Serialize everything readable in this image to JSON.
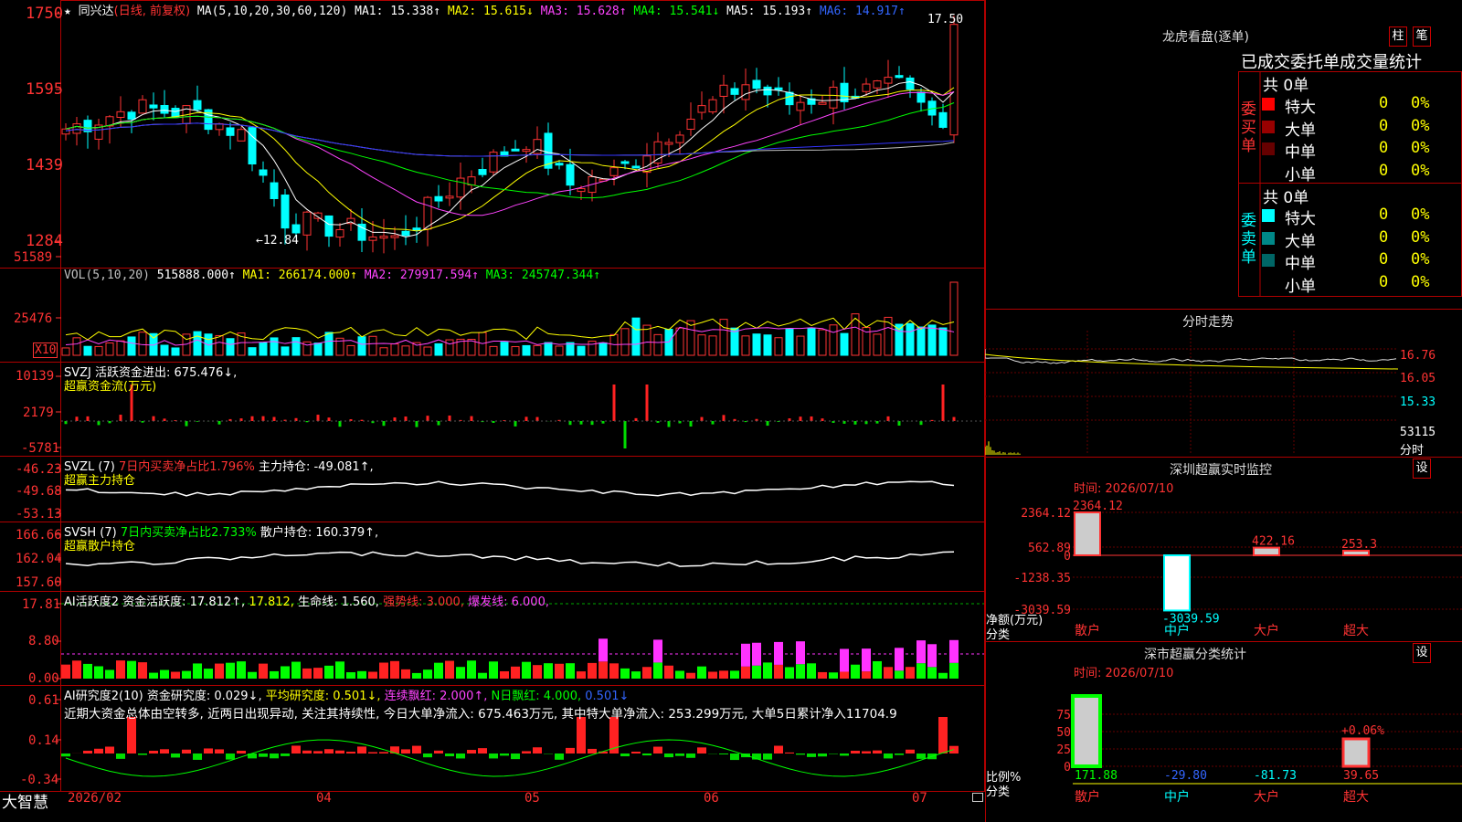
{
  "header": {
    "stock_name": "同兴达",
    "period": "(日线, 前复权)",
    "ma_params": "MA(5,10,20,30,60,120)",
    "ma1": "MA1: 15.338↑",
    "ma2": "MA2: 15.615↓",
    "ma3": "MA3: 15.628↑",
    "ma4": "MA4: 15.541↓",
    "ma5": "MA5: 15.193↑",
    "ma6": "MA6: 14.917↑",
    "high_marker": "17.50",
    "low_marker": "←12.84"
  },
  "price_axis": [
    "1750",
    "1595",
    "1439",
    "1284"
  ],
  "vol": {
    "params": "VOL(5,10,20)",
    "value": "515888.000↑",
    "ma1": "MA1: 266174.000↑",
    "ma2": "MA2: 279917.594↑",
    "ma3": "MA3: 245747.344↑",
    "axis": [
      "51589",
      "25476"
    ],
    "unit": "X10"
  },
  "svzj": {
    "line1": "SVZJ  活跃资金进出: 675.476↓,",
    "line2": "超赢资金流(万元)",
    "axis": [
      "10139",
      "2179",
      "-5781"
    ]
  },
  "svzl": {
    "name": "SVZL (7)",
    "ratio": "7日内买卖净占比1.796%",
    "hold": "主力持仓: -49.081↑,",
    "line2": "超赢主力持仓",
    "axis": [
      "-46.23",
      "-49.68",
      "-53.13"
    ]
  },
  "svsh": {
    "name": "SVSH (7)",
    "ratio": "7日内买卖净占比2.733%",
    "hold": "散户持仓: 160.379↑,",
    "line2": "超赢散户持仓",
    "axis": [
      "166.66",
      "162.04",
      "157.60"
    ]
  },
  "ai_active": {
    "name": "AI活跃度2",
    "v1": "资金活跃度: 17.812↑,",
    "v2": "17.812,",
    "v3": "生命线: 1.560,",
    "v4": "强势线: 3.000,",
    "v5": "爆发线: 6.000,",
    "axis": [
      "17.81",
      "8.80",
      "0.00"
    ]
  },
  "ai_research": {
    "name": "AI研究度2(10)",
    "v1": "资金研究度: 0.029↓,",
    "v2": "平均研究度: 0.501↓,",
    "v3": "连续飘红: 2.000↑,",
    "v4": "N日飘红: 4.000,",
    "v5": "0.501↓",
    "comment": "近期大资金总体由空转多, 近两日出现异动, 关注其持续性, 今日大单净流入: 675.463万元, 其中特大单净流入: 253.299万元, 大单5日累计净入11704.9",
    "axis": [
      "0.61",
      "0.14",
      "-0.34"
    ]
  },
  "footer": {
    "brand": "大智慧",
    "dates": [
      "2026/02",
      "04",
      "05",
      "06",
      "07"
    ]
  },
  "right_panel": {
    "title": "龙虎看盘(逐单)",
    "btn1": "柱",
    "btn2": "笔",
    "stats_title": "已成交委托单成交量统计",
    "buy_side": "委买单",
    "sell_side": "委卖单",
    "buy_total": "共 0单",
    "sell_total": "共 0单",
    "buy_rows": [
      {
        "label": "特大",
        "count": "0",
        "pct": "0%",
        "color": "#ff0000"
      },
      {
        "label": "大单",
        "count": "0",
        "pct": "0%",
        "color": "#990000"
      },
      {
        "label": "中单",
        "count": "0",
        "pct": "0%",
        "color": "#660000"
      },
      {
        "label": "小单",
        "count": "0",
        "pct": "0%",
        "color": "#000000"
      }
    ],
    "sell_rows": [
      {
        "label": "特大",
        "count": "0",
        "pct": "0%",
        "color": "#00ffff"
      },
      {
        "label": "大单",
        "count": "0",
        "pct": "0%",
        "color": "#008888"
      },
      {
        "label": "中单",
        "count": "0",
        "pct": "0%",
        "color": "#006666"
      },
      {
        "label": "小单",
        "count": "0",
        "pct": "0%",
        "color": "#000000"
      }
    ],
    "intraday_title": "分时走势",
    "intraday_axis": [
      "16.76",
      "16.05",
      "15.33"
    ],
    "intraday_vol": "53115",
    "intraday_label": "分时",
    "monitor_title": "深圳超赢实时监控",
    "monitor_btn": "设",
    "monitor_time": "时间: 2026/07/10",
    "monitor_axis": [
      "2364.12",
      "562.89",
      "0",
      "-1238.35",
      "-3039.59"
    ],
    "monitor_ylabel": "净额(万元)",
    "monitor_xlabel": "分类",
    "categories": [
      "散户",
      "中户",
      "大户",
      "超大"
    ],
    "monitor_values": [
      "2364.12",
      "-3039.59",
      "422.16",
      "253.3"
    ],
    "class_title": "深市超赢分类统计",
    "class_btn": "设",
    "class_time": "时间: 2026/07/10",
    "class_axis": [
      "75",
      "50",
      "25",
      "0"
    ],
    "class_ylabel": "比例%",
    "class_xlabel": "分类",
    "class_values": [
      "171.88",
      "-29.80",
      "-81.73",
      "39.65"
    ],
    "class_pct_label": "+0.06%"
  }
}
